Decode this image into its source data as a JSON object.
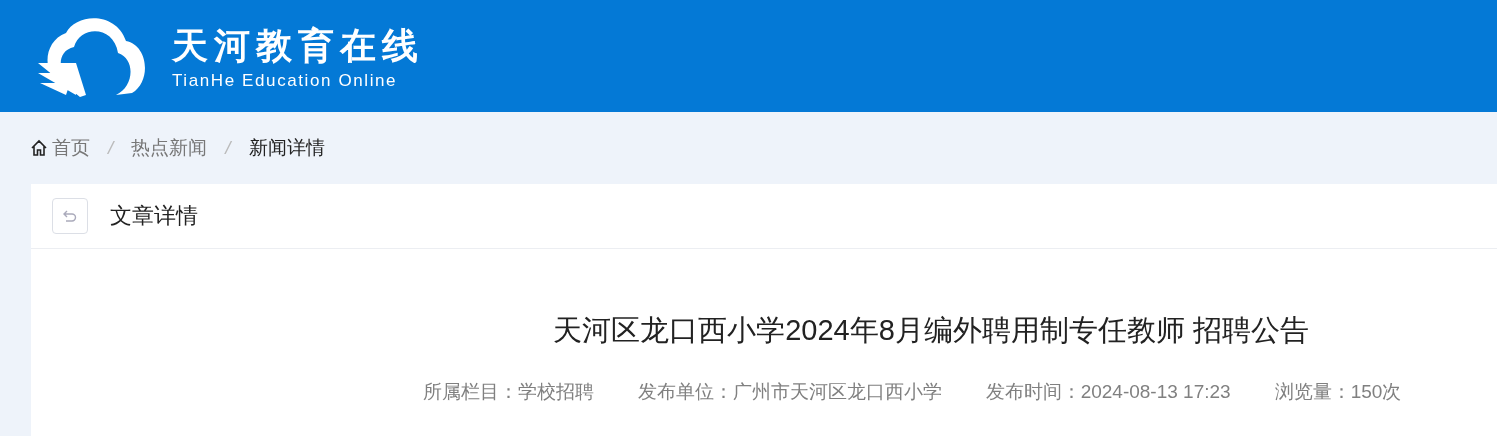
{
  "header": {
    "title": "天河教育在线",
    "subtitle": "TianHe Education Online"
  },
  "breadcrumb": [
    {
      "label": "首页",
      "current": false
    },
    {
      "label": "热点新闻",
      "current": false
    },
    {
      "label": "新闻详情",
      "current": true
    }
  ],
  "breadcrumb_separator": "/",
  "card": {
    "title": "文章详情"
  },
  "article": {
    "title": "天河区龙口西小学2024年8月编外聘用制专任教师 招聘公告",
    "meta": [
      "所属栏目：学校招聘",
      "发布单位：广州市天河区龙口西小学",
      "发布时间：2024-08-13 17:23",
      "浏览量：150次"
    ]
  }
}
